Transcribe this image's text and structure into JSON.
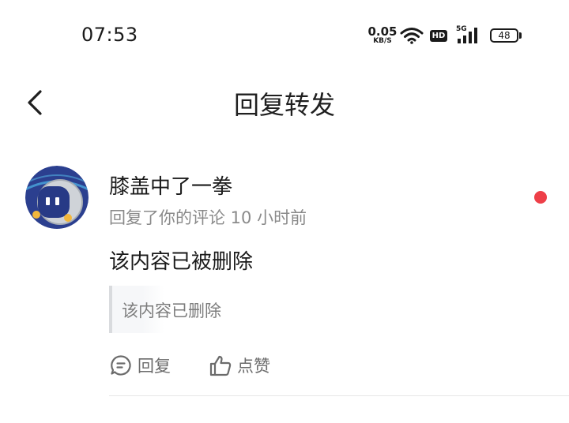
{
  "status_bar": {
    "time": "07:53",
    "net_speed": "0.05",
    "net_unit": "KB/S",
    "hd": "HD",
    "signal": "5G",
    "battery": "48"
  },
  "header": {
    "title": "回复转发",
    "back_icon": "chevron-left-icon"
  },
  "comment": {
    "user_name": "膝盖中了一拳",
    "meta": "回复了你的评论 10 小时前",
    "content": "该内容已被删除",
    "quote": "该内容已删除",
    "unread_color": "#ee3f48",
    "actions": {
      "reply_label": "回复",
      "reply_icon": "comment-icon",
      "like_label": "点赞",
      "like_icon": "thumbs-up-icon"
    }
  }
}
